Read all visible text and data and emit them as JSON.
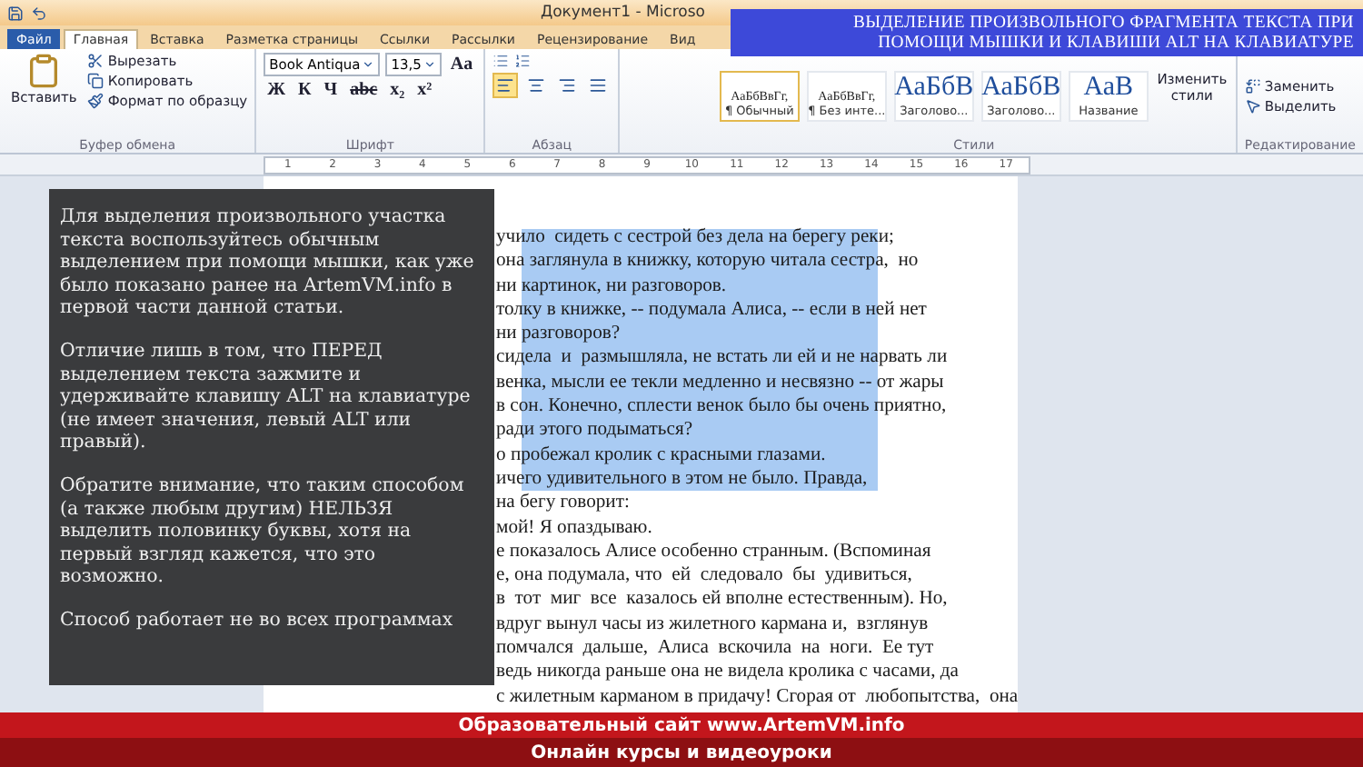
{
  "window": {
    "title": "Документ1 - Microso"
  },
  "tabs": [
    {
      "label": "Файл",
      "kind": "file",
      "selected": false
    },
    {
      "label": "Главная",
      "kind": "tab",
      "selected": true
    },
    {
      "label": "Вставка",
      "kind": "tab",
      "selected": false
    },
    {
      "label": "Разметка страницы",
      "kind": "tab",
      "selected": false
    },
    {
      "label": "Ссылки",
      "kind": "tab",
      "selected": false
    },
    {
      "label": "Рассылки",
      "kind": "tab",
      "selected": false
    },
    {
      "label": "Рецензирование",
      "kind": "tab",
      "selected": false
    },
    {
      "label": "Вид",
      "kind": "tab",
      "selected": false
    }
  ],
  "clipboard": {
    "paste": "Вставить",
    "items": [
      "Вырезать",
      "Копировать",
      "Формат по образцу"
    ],
    "label": "Буфер обмена"
  },
  "font": {
    "name": "Book Antiqua",
    "size": "13,5",
    "case": "Aa",
    "buttons": [
      "Ж",
      "К",
      "Ч",
      "abc",
      "x₂",
      "x²"
    ],
    "label": "Шрифт"
  },
  "paragraph": {
    "label": "Абзац",
    "alignments": [
      {
        "selected": true
      },
      {
        "selected": false
      },
      {
        "selected": false
      },
      {
        "selected": false
      }
    ]
  },
  "styles": {
    "items": [
      {
        "sample": "АаБбВвГг,",
        "name": "¶ Обычный",
        "selected": true
      },
      {
        "sample": "АаБбВвГг,",
        "name": "¶ Без инте...",
        "selected": false
      },
      {
        "sample": "АаБбВ",
        "name": "Заголово...",
        "selected": false
      },
      {
        "sample": "АаБбВ",
        "name": "Заголово...",
        "selected": false
      },
      {
        "sample": "АаВ",
        "name": "Название",
        "selected": false
      }
    ],
    "change": "Изменить стили",
    "label": "Стили"
  },
  "editing": {
    "items": [
      "Заменить",
      "Выделить"
    ],
    "label": "Редактирование"
  },
  "ruler_numbers": [
    "1",
    "2",
    "3",
    "4",
    "5",
    "6",
    "7",
    "8",
    "9",
    "10",
    "11",
    "12",
    "13",
    "14",
    "15",
    "16",
    "17"
  ],
  "banner": {
    "lines": [
      "ВЫДЕЛЕНИЕ ПРОИЗВОЛЬНОГО ФРАГМЕНТА ТЕКСТА ПРИ",
      "ПОМОЩИ МЫШКИ И КЛАВИШИ ALT НА КЛАВИАТУРЕ"
    ]
  },
  "document": {
    "lines": [
      "учило  сидеть с сестрой без дела на берегу реки;",
      "она заглянула в книжку, которую читала сестра,  но",
      "ни картинок, ни разговоров.",
      "толку в книжке, -- подумала Алиса, -- если в ней нет",
      "ни разговоров?",
      "сидела  и  размышляла, не встать ли ей и не нарвать ли",
      "венка, мысли ее текли медленно и несвязно -- от жары",
      "в сон. Конечно, сплести венок было бы очень приятно,",
      "ради этого подыматься?",
      "о пробежал кролик с красными глазами.",
      "ичего удивительного в этом не было. Правда,",
      "на бегу говорит:",
      "мой! Я опаздываю.",
      "е показалось Алисе особенно странным. (Вспоминая",
      "е, она подумала, что  ей  следовало  бы  удивиться,",
      "в  тот  миг  все  казалось ей вполне естественным). Но,",
      "вдруг вынул часы из жилетного кармана и,  взглянув",
      "помчался  дальше,  Алиса  вскочила  на  ноги.  Ее тут",
      "ведь никогда раньше она не видела кролика с часами, да",
      "с жилетным карманом в придачу! Сгорая от  любопытства,  она"
    ]
  },
  "note": {
    "paragraphs": [
      "Для выделения произвольного участка текста воспользуйтесь обычным выделением при помощи мышки, как уже было показано ранее на ArtemVM.info в первой части данной статьи.",
      "Отличие лишь в том, что ПЕРЕД выделением текста зажмите и удерживайте клавишу ALT на клавиатуре (не имеет значения, левый ALT или правый).",
      "Обратите внимание, что таким способом (а также любым другим) НЕЛЬЗЯ выделить половинку буквы, хотя на первый взгляд кажется, что это возможно.",
      "Способ работает не во всех программах"
    ]
  },
  "footer": {
    "site": "Образовательный сайт www.ArtemVM.info",
    "tagline": "Онлайн курсы и видеоуроки"
  }
}
